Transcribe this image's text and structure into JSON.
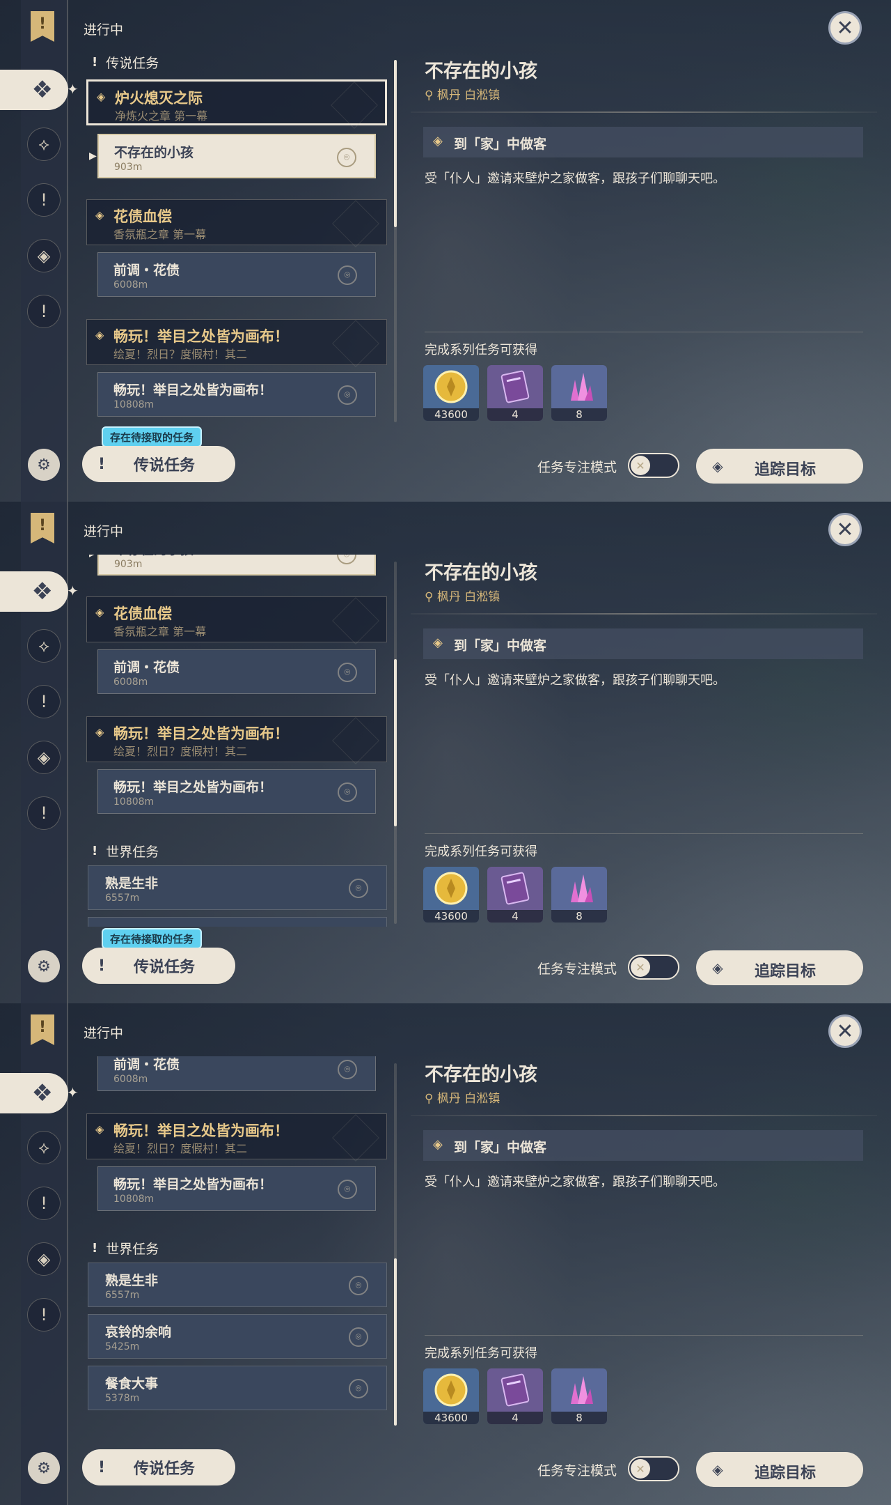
{
  "status_title": "进行中",
  "legend_category": "传说任务",
  "world_category": "世界任务",
  "chains": [
    {
      "title": "炉火熄灭之际",
      "subtitle": "净炼火之章 第一幕"
    },
    {
      "title": "花债血偿",
      "subtitle": "香氛瓶之章 第一幕"
    },
    {
      "title": "畅玩！举目之处皆为画布！",
      "subtitle": "绘夏！烈日？度假村！其二"
    }
  ],
  "subquests": [
    {
      "title": "不存在的小孩",
      "distance": "903m"
    },
    {
      "title": "前调・花债",
      "distance": "6008m"
    },
    {
      "title": "畅玩！举目之处皆为画布！",
      "distance": "10808m"
    }
  ],
  "world_quests": [
    {
      "title": "熟是生非",
      "distance": "6557m"
    },
    {
      "title": "哀铃的余响",
      "distance": "5425m"
    },
    {
      "title": "餐食大事",
      "distance": "5378m"
    }
  ],
  "pending_badge": "存在待接取的任务",
  "legend_button": "传说任务",
  "detail": {
    "title": "不存在的小孩",
    "location": "枫丹 白淞镇",
    "objective": "到「家」中做客",
    "description": "受「仆人」邀请来壁炉之家做客，跟孩子们聊聊天吧。",
    "rewards_label": "完成系列任务可获得",
    "rewards": [
      {
        "icon": "mora-coin-icon",
        "count": "43600",
        "color": "#4a6a96"
      },
      {
        "icon": "experience-book-icon",
        "count": "4",
        "color": "#6a5a92"
      },
      {
        "icon": "crystal-icon",
        "count": "8",
        "color": "#5a6a9a"
      }
    ]
  },
  "focus_mode_label": "任务专注模式",
  "focus_mode_on": false,
  "track_button": "追踪目标",
  "panels": [
    {
      "scroll_position": 0.0,
      "show_pending_badge": true
    },
    {
      "scroll_position": 0.5,
      "show_pending_badge": true
    },
    {
      "scroll_position": 1.0,
      "show_pending_badge": false
    }
  ],
  "colors": {
    "accent": "#ece5d8",
    "gold": "#e8c98a",
    "badge": "#5fd0f0"
  }
}
